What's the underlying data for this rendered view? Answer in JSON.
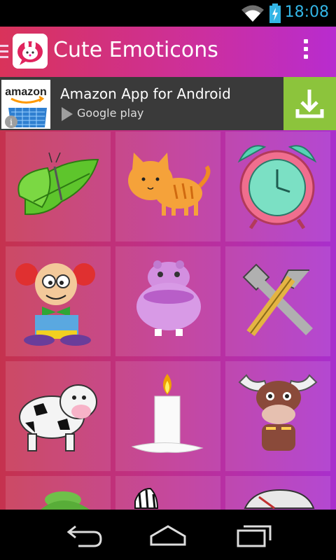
{
  "status_bar": {
    "time": "18:08",
    "icons": [
      "wifi-icon",
      "battery-charging-icon"
    ]
  },
  "app_bar": {
    "title": "Cute Emoticons",
    "logo": "bunny-chat-logo",
    "menu_icon": "overflow-menu-icon"
  },
  "ad": {
    "brand": "amazon",
    "title": "Amazon App for Android",
    "store_label": "Google play",
    "action_icon": "download-icon",
    "info_icon": "info-icon"
  },
  "grid": {
    "items": [
      {
        "name": "butterfly"
      },
      {
        "name": "cat"
      },
      {
        "name": "alarm-clock"
      },
      {
        "name": "clown"
      },
      {
        "name": "hippo"
      },
      {
        "name": "tools"
      },
      {
        "name": "cow"
      },
      {
        "name": "candle"
      },
      {
        "name": "buffalo"
      },
      {
        "name": "knit-hat"
      },
      {
        "name": "zebra"
      },
      {
        "name": "clock-partial"
      }
    ]
  },
  "nav_bar": {
    "buttons": [
      "back-icon",
      "home-icon",
      "recent-apps-icon"
    ]
  },
  "colors": {
    "accent": "#33b5e5",
    "app_bar_start": "#d9335a",
    "app_bar_end": "#b82ccf",
    "download_green": "#8cc43c"
  }
}
